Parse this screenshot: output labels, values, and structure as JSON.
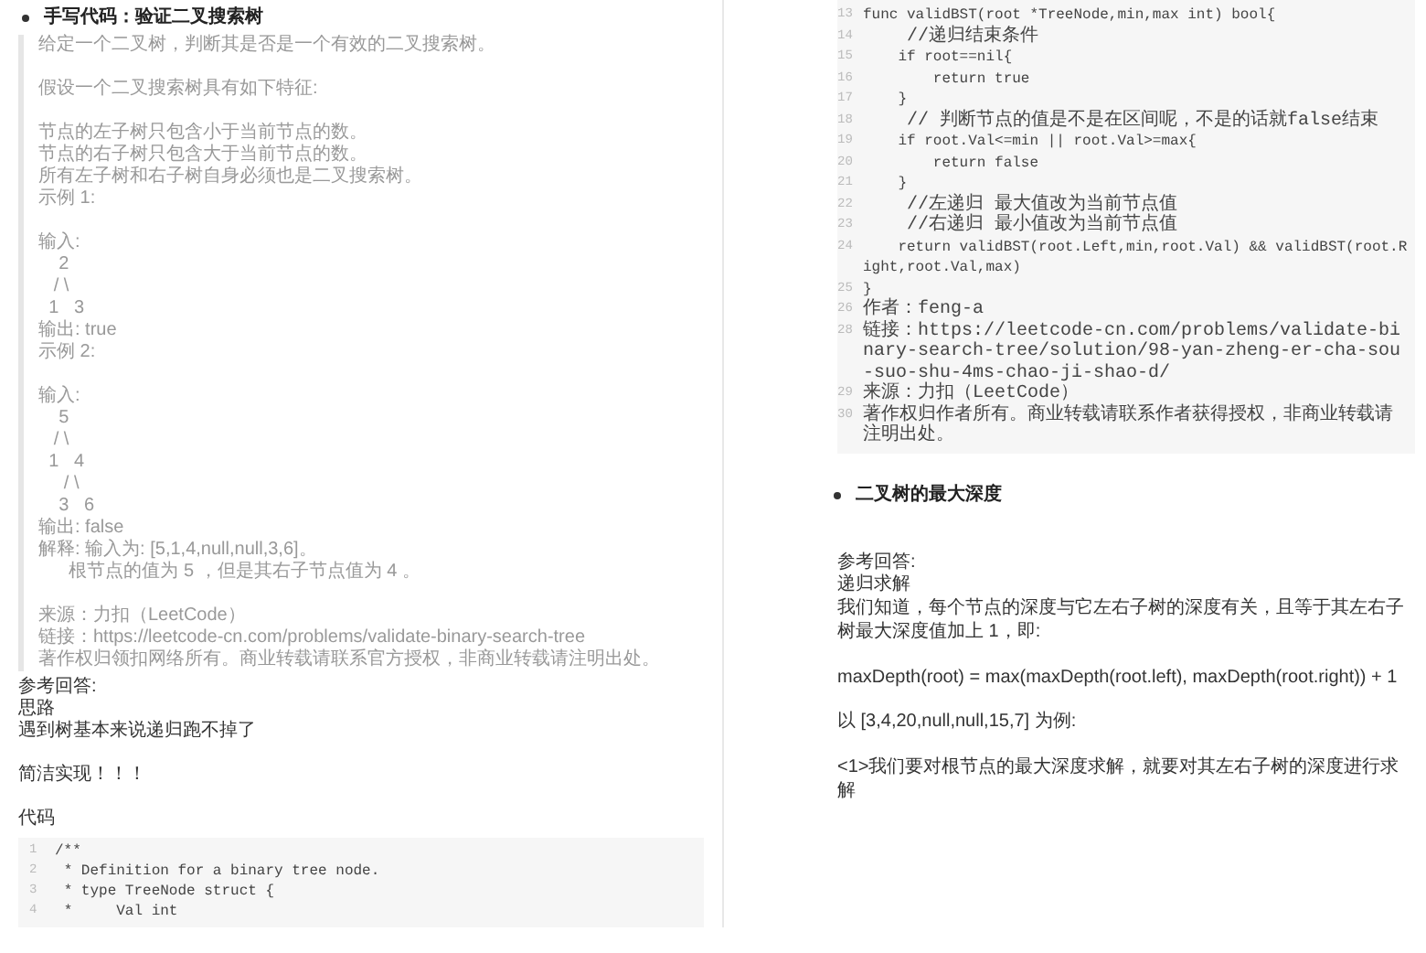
{
  "left_page": {
    "heading": "手写代码：验证二叉搜索树",
    "quote": [
      [
        "给定一个二叉树，判断其是否是一个有效的二叉搜索树。"
      ],
      [
        "假设一个二叉搜索树具有如下特征:"
      ],
      [
        "节点的左子树只包含小于当前节点的数。",
        "节点的右子树只包含大于当前节点的数。",
        "所有左子树和右子树自身必须也是二叉搜索树。",
        "示例 1:"
      ],
      [
        "输入:",
        "    2",
        "   / \\",
        "  1   3",
        "输出: true",
        "示例 2:"
      ],
      [
        "输入:",
        "    5",
        "   / \\",
        "  1   4",
        "     / \\",
        "    3   6",
        "输出: false",
        "解释: 输入为: [5,1,4,null,null,3,6]。",
        "      根节点的值为 5 ，但是其右子节点值为 4 。"
      ],
      [
        "来源：力扣（LeetCode）",
        "链接：https://leetcode-cn.com/problems/validate-binary-search-tree",
        "著作权归领扣网络所有。商业转载请联系官方授权，非商业转载请注明出处。"
      ]
    ],
    "answer": [
      [
        "参考回答:",
        "思路",
        "遇到树基本来说递归跑不掉了"
      ],
      [
        "简洁实现！！！"
      ],
      [
        "代码"
      ]
    ],
    "code": [
      {
        "number": "1",
        "text": "/**"
      },
      {
        "number": "2",
        "text": " * Definition for a binary tree node."
      },
      {
        "number": "3",
        "text": " * type TreeNode struct {"
      },
      {
        "number": "4",
        "text": " *     Val int"
      }
    ]
  },
  "right_page": {
    "code": [
      {
        "number": "13",
        "text": "func validBST(root *TreeNode,min,max int) bool{"
      },
      {
        "number": "14",
        "text": "    //递归结束条件"
      },
      {
        "number": "15",
        "text": "    if root==nil{"
      },
      {
        "number": "16",
        "text": "        return true"
      },
      {
        "number": "17",
        "text": "    }"
      },
      {
        "number": "18",
        "text": "    // 判断节点的值是不是在区间呢，不是的话就false结束"
      },
      {
        "number": "19",
        "text": "    if root.Val<=min || root.Val>=max{"
      },
      {
        "number": "20",
        "text": "        return false"
      },
      {
        "number": "21",
        "text": "    }"
      },
      {
        "number": "22",
        "text": "    //左递归 最大值改为当前节点值"
      },
      {
        "number": "23",
        "text": "    //右递归 最小值改为当前节点值"
      },
      {
        "number": "24",
        "text": "    return validBST(root.Left,min,root.Val) && validBST(root.Right,root.Val,max)"
      },
      {
        "number": "25",
        "text": "}"
      },
      {
        "number": "26",
        "text": "作者：feng-a"
      },
      {
        "number": "28",
        "text": "链接：https://leetcode-cn.com/problems/validate-binary-search-tree/solution/98-yan-zheng-er-cha-sou-suo-shu-4ms-chao-ji-shao-d/"
      },
      {
        "number": "29",
        "text": "来源：力扣（LeetCode）"
      },
      {
        "number": "30",
        "text": "著作权归作者所有。商业转载请联系作者获得授权，非商业转载请注明出处。"
      }
    ],
    "heading": "二叉树的最大深度",
    "answer": [
      [
        "参考回答:",
        "递归求解",
        "我们知道，每个节点的深度与它左右子树的深度有关，且等于其左右子树最大深度值加上 1，即:"
      ],
      [
        "maxDepth(root) = max(maxDepth(root.left), maxDepth(root.right)) + 1"
      ],
      [
        "以 [3,4,20,null,null,15,7] 为例:"
      ],
      [
        "<1>我们要对根节点的最大深度求解，就要对其左右子树的深度进行求解"
      ]
    ]
  }
}
